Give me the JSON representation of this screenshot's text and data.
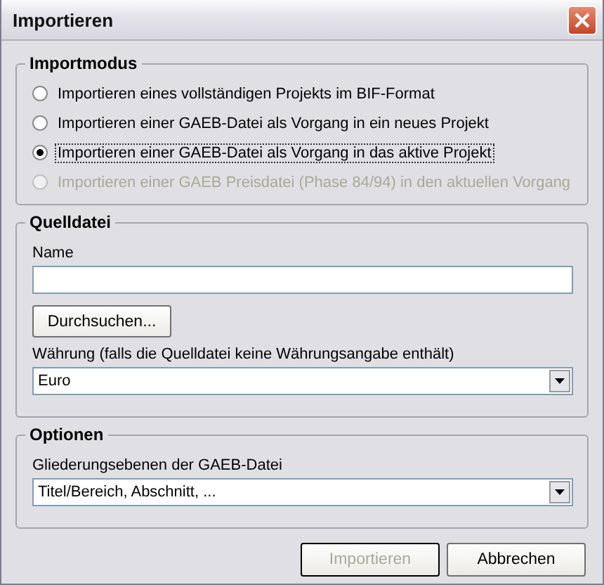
{
  "window": {
    "title": "Importieren"
  },
  "import_mode": {
    "title": "Importmodus",
    "options": [
      {
        "label": "Importieren eines vollständigen Projekts im BIF-Format",
        "selected": false,
        "disabled": false,
        "focused": false
      },
      {
        "label": "Importieren einer GAEB-Datei als Vorgang in ein neues Projekt",
        "selected": false,
        "disabled": false,
        "focused": false
      },
      {
        "label": "Importieren einer GAEB-Datei als Vorgang in das aktive Projekt",
        "selected": true,
        "disabled": false,
        "focused": true
      },
      {
        "label": "Importieren einer GAEB Preisdatei (Phase 84/94) in den aktuellen Vorgang",
        "selected": false,
        "disabled": true,
        "focused": false
      }
    ]
  },
  "source_file": {
    "title": "Quelldatei",
    "name_label": "Name",
    "browse_button": "Durchsuchen...",
    "currency_label": "Währung (falls die Quelldatei keine Währungsangabe enthält)",
    "currency_value": "Euro"
  },
  "options": {
    "title": "Optionen",
    "levels_label": "Gliederungsebenen der GAEB-Datei",
    "levels_value": "Titel/Bereich, Abschnitt, ..."
  },
  "buttons": [
    {
      "label": "Importieren",
      "disabled": true
    },
    {
      "label": "Abbrechen",
      "disabled": false
    }
  ]
}
